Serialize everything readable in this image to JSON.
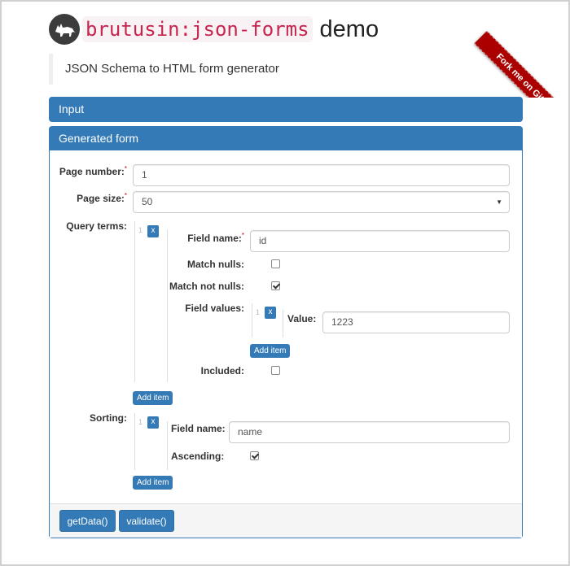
{
  "header": {
    "logo_icon": "fox-icon",
    "code_title": "brutusin:json-forms",
    "demo_word": "demo",
    "ribbon_text": "Fork me on GitHub",
    "subtitle": "JSON Schema to HTML form generator"
  },
  "panels": {
    "input_title": "Input",
    "generated_title": "Generated form"
  },
  "form": {
    "page_number": {
      "label": "Page number:",
      "required": "*",
      "value": "1"
    },
    "page_size": {
      "label": "Page size:",
      "required": "*",
      "value": "50"
    },
    "query_terms": {
      "label": "Query terms:",
      "items": [
        {
          "index": "1",
          "remove_label": "x",
          "field_name": {
            "label": "Field name:",
            "required": "*",
            "value": "id"
          },
          "match_nulls": {
            "label": "Match nulls:",
            "checked": false
          },
          "match_not_nulls": {
            "label": "Match not nulls:",
            "checked": true
          },
          "field_values": {
            "label": "Field values:",
            "items": [
              {
                "index": "1",
                "remove_label": "x",
                "value_label": "Value:",
                "value": "1223"
              }
            ],
            "add_label": "Add item"
          },
          "included": {
            "label": "Included:",
            "checked": false
          }
        }
      ],
      "add_label": "Add item"
    },
    "sorting": {
      "label": "Sorting:",
      "items": [
        {
          "index": "1",
          "remove_label": "x",
          "field_name": {
            "label": "Field name:",
            "value": "name"
          },
          "ascending": {
            "label": "Ascending:",
            "checked": true
          }
        }
      ],
      "add_label": "Add item"
    }
  },
  "footer": {
    "get_data_label": "getData()",
    "validate_label": "validate()"
  },
  "colors": {
    "primary": "#337ab7",
    "code_text": "#c7254e",
    "code_bg": "#f9f2f4",
    "ribbon": "#aa0000"
  }
}
